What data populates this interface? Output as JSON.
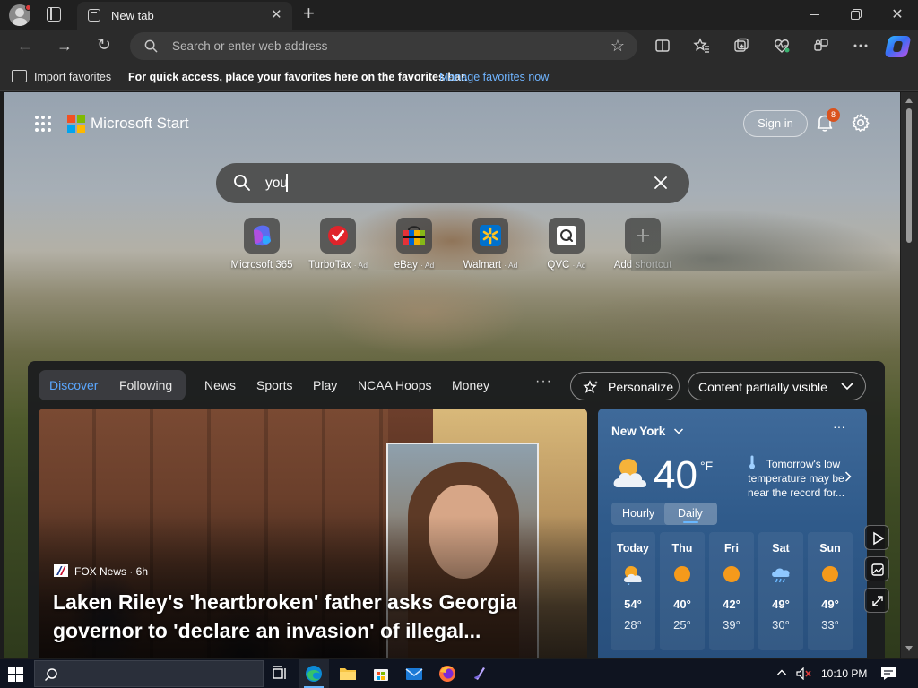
{
  "browser": {
    "tab": {
      "title": "New tab"
    },
    "address": {
      "placeholder": "Search or enter web address"
    },
    "favorites_bar": {
      "import_label": "Import favorites",
      "hint": "For quick access, place your favorites here on the favorites bar.",
      "manage_link": "Manage favorites now"
    }
  },
  "start_page": {
    "brand": "Microsoft Start",
    "sign_in": "Sign in",
    "notifications_count": "8",
    "search": {
      "value": "you"
    },
    "shortcuts": [
      {
        "name": "Microsoft 365",
        "ad": "",
        "icon": "microsoft365-icon"
      },
      {
        "name": "TurboTax",
        "ad": "· Ad",
        "icon": "turbotax-icon"
      },
      {
        "name": "eBay",
        "ad": "· Ad",
        "icon": "ebay-icon"
      },
      {
        "name": "Walmart",
        "ad": "· Ad",
        "icon": "walmart-icon"
      },
      {
        "name": "QVC",
        "ad": "· Ad",
        "icon": "qvc-icon"
      },
      {
        "name": "Add shortcut",
        "ad": "",
        "icon": "plus-icon"
      }
    ],
    "feed_tabs": {
      "discover": "Discover",
      "following": "Following"
    },
    "feed_nav": [
      "News",
      "Sports",
      "Play",
      "NCAA Hoops",
      "Money"
    ],
    "more_label": "···",
    "personalize": "Personalize",
    "content_visibility": "Content partially visible",
    "hero": {
      "source": "FOX News · 6h",
      "headline": "Laken Riley's 'heartbroken' father asks Georgia governor to 'declare an invasion' of illegal..."
    },
    "weather": {
      "city": "New York",
      "temperature": "40",
      "unit": "°F",
      "alert": "Tomorrow's low temperature may be near the record for...",
      "toggle": {
        "hourly": "Hourly",
        "daily": "Daily"
      },
      "days": [
        {
          "name": "Today",
          "high": "54°",
          "low": "28°",
          "icon": "partly-cloudy-icon"
        },
        {
          "name": "Thu",
          "high": "40°",
          "low": "25°",
          "icon": "sun-icon"
        },
        {
          "name": "Fri",
          "high": "42°",
          "low": "39°",
          "icon": "sun-icon"
        },
        {
          "name": "Sat",
          "high": "49°",
          "low": "30°",
          "icon": "rain-icon"
        },
        {
          "name": "Sun",
          "high": "49°",
          "low": "33°",
          "icon": "sun-icon"
        }
      ]
    }
  },
  "taskbar": {
    "time": "10:10 PM"
  },
  "colors": {
    "accent_link": "#6fb4ff",
    "discover_active": "#5aa7ff",
    "notification_badge": "#d9531e"
  }
}
